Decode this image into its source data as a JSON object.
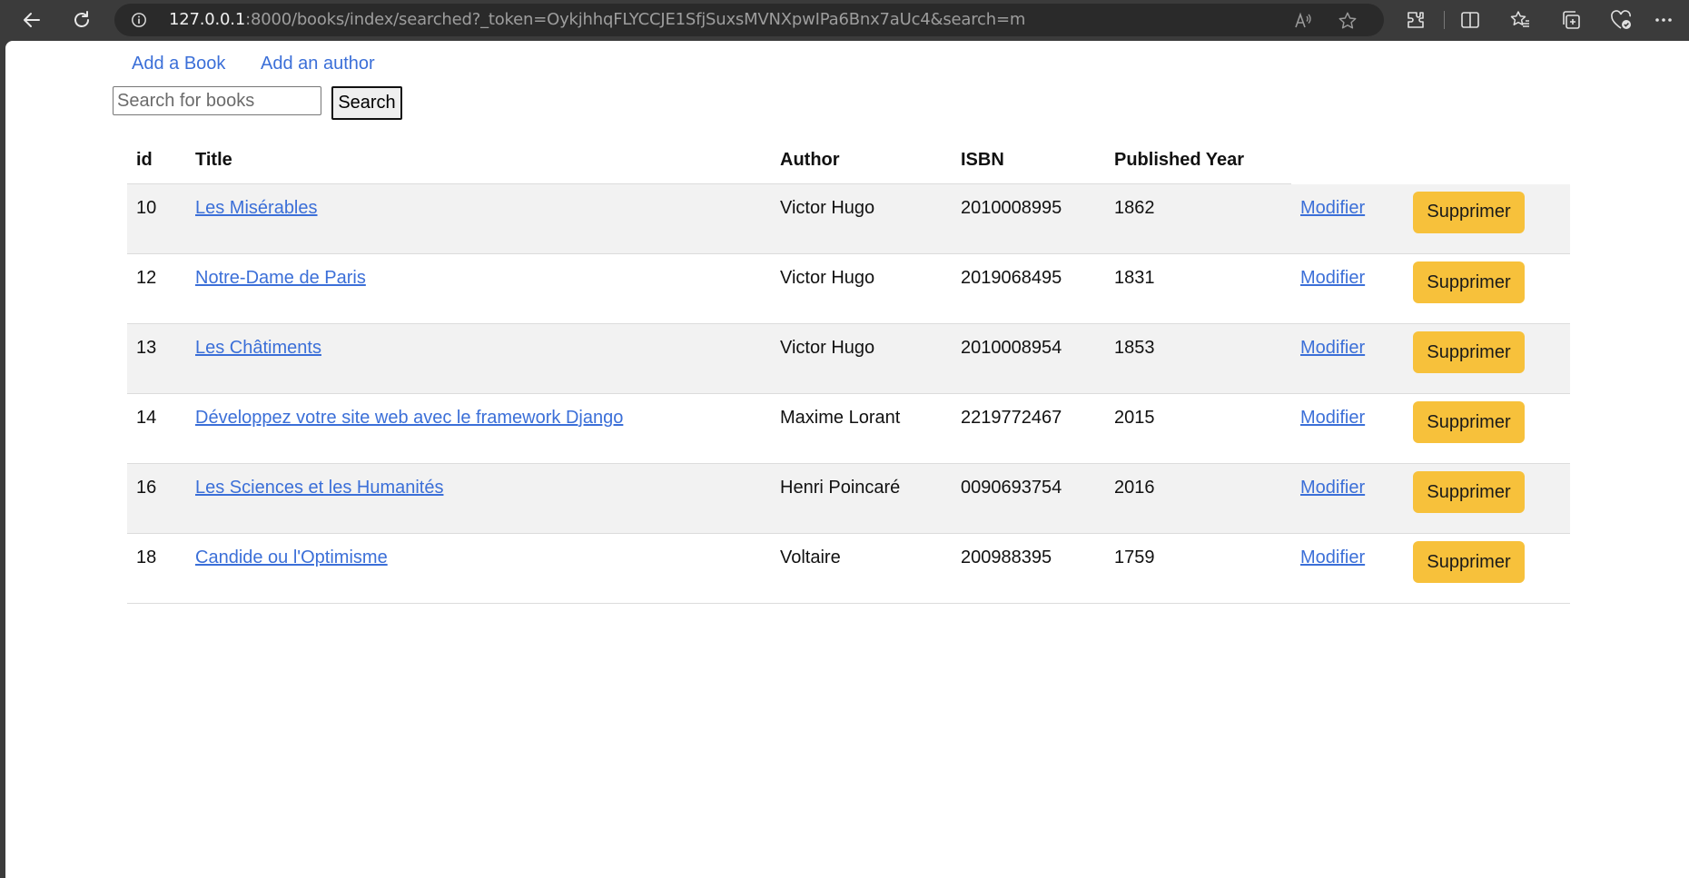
{
  "browser": {
    "url_host": "127.0.0.1",
    "url_rest": ":8000/books/index/searched?_token=OykjhhqFLYCCJE1SfjSuxsMVNXpwIPa6Bnx7aUc4&search=m"
  },
  "nav": {
    "add_book": "Add a Book",
    "add_author": "Add an author"
  },
  "search": {
    "placeholder": "Search for books",
    "button": "Search"
  },
  "table": {
    "headers": {
      "id": "id",
      "title": "Title",
      "author": "Author",
      "isbn": "ISBN",
      "year": "Published Year"
    },
    "rows": [
      {
        "id": "10",
        "title": "Les Misérables",
        "author": "Victor Hugo",
        "isbn": "2010008995",
        "year": "1862",
        "modify": "Modifier",
        "delete": "Supprimer"
      },
      {
        "id": "12",
        "title": "Notre-Dame de Paris",
        "author": "Victor Hugo",
        "isbn": "2019068495",
        "year": "1831",
        "modify": "Modifier",
        "delete": "Supprimer"
      },
      {
        "id": "13",
        "title": "Les Châtiments",
        "author": "Victor Hugo",
        "isbn": "2010008954",
        "year": "1853",
        "modify": "Modifier",
        "delete": "Supprimer"
      },
      {
        "id": "14",
        "title": "Développez votre site web avec le framework Django",
        "author": "Maxime Lorant",
        "isbn": "2219772467",
        "year": "2015",
        "modify": "Modifier",
        "delete": "Supprimer"
      },
      {
        "id": "16",
        "title": "Les Sciences et les Humanités",
        "author": "Henri Poincaré",
        "isbn": "0090693754",
        "year": "2016",
        "modify": "Modifier",
        "delete": "Supprimer"
      },
      {
        "id": "18",
        "title": "Candide ou l'Optimisme",
        "author": "Voltaire",
        "isbn": "200988395",
        "year": "1759",
        "modify": "Modifier",
        "delete": "Supprimer"
      }
    ]
  },
  "colors": {
    "link": "#3b6fd8",
    "delete_button": "#f7c13b",
    "stripe": "#f2f2f2"
  }
}
